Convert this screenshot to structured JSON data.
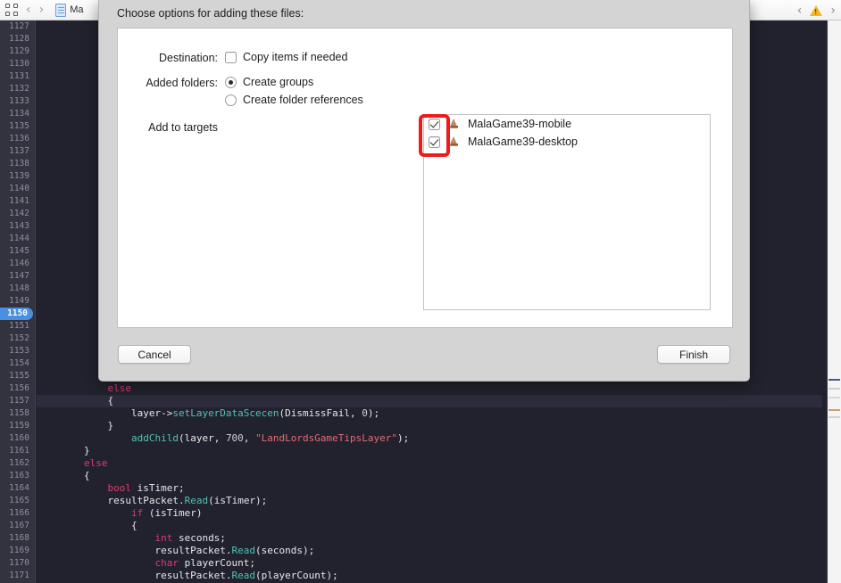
{
  "toolbar": {
    "grid_icon": "grid-panels-icon",
    "back_label": "‹",
    "forward_label": "›",
    "tab_label": "Ma",
    "nav_prev_label": "‹",
    "nav_next_label": "›",
    "warning_icon": "warning-triangle-icon"
  },
  "dialog": {
    "title": "Choose options for adding these files:",
    "destination": {
      "label": "Destination:",
      "checkbox_label": "Copy items if needed",
      "checked": false
    },
    "added_folders": {
      "label": "Added folders:",
      "options": [
        {
          "label": "Create groups",
          "selected": true
        },
        {
          "label": "Create folder references",
          "selected": false
        }
      ]
    },
    "add_to_targets": {
      "label": "Add to targets",
      "items": [
        {
          "label": "MalaGame39-mobile",
          "checked": true,
          "icon": "target-icon"
        },
        {
          "label": "MalaGame39-desktop",
          "checked": true,
          "icon": "target-icon"
        }
      ]
    },
    "cancel_label": "Cancel",
    "finish_label": "Finish",
    "annotation_color": "#ee1b1b"
  },
  "editor": {
    "first_line_number": 1127,
    "current_line": 1157,
    "marker_line": 1150,
    "accent_blue": "#4a8fe0",
    "background": "#22222e",
    "gutter_background": "#33333f",
    "lines": [
      {
        "n": 1127,
        "tokens": []
      },
      {
        "n": 1128,
        "tokens": []
      },
      {
        "n": 1129,
        "tokens": []
      },
      {
        "n": 1130,
        "tokens": []
      },
      {
        "n": 1131,
        "tokens": []
      },
      {
        "n": 1132,
        "tokens": []
      },
      {
        "n": 1133,
        "tokens": []
      },
      {
        "n": 1134,
        "tokens": []
      },
      {
        "n": 1135,
        "tokens": []
      },
      {
        "n": 1136,
        "tokens": []
      },
      {
        "n": 1137,
        "tokens": []
      },
      {
        "n": 1138,
        "tokens": []
      },
      {
        "n": 1139,
        "tokens": []
      },
      {
        "n": 1140,
        "tokens": []
      },
      {
        "n": 1141,
        "tokens": []
      },
      {
        "n": 1142,
        "tokens": []
      },
      {
        "n": 1143,
        "tokens": []
      },
      {
        "n": 1144,
        "tokens": []
      },
      {
        "n": 1145,
        "tokens": []
      },
      {
        "n": 1146,
        "tokens": []
      },
      {
        "n": 1147,
        "tokens": []
      },
      {
        "n": 1148,
        "tokens": []
      },
      {
        "n": 1149,
        "tokens": []
      },
      {
        "n": 1150,
        "tokens": [],
        "marker": true
      },
      {
        "n": 1151,
        "tokens": []
      },
      {
        "n": 1152,
        "tokens": []
      },
      {
        "n": 1153,
        "tokens": []
      },
      {
        "n": 1154,
        "tokens": []
      },
      {
        "n": 1155,
        "tokens": [
          {
            "t": "            }",
            "c": "pl"
          }
        ]
      },
      {
        "n": 1156,
        "tokens": [
          {
            "t": "            ",
            "c": "pl"
          },
          {
            "t": "else",
            "c": "kw"
          }
        ]
      },
      {
        "n": 1157,
        "tokens": [
          {
            "t": "            {",
            "c": "pl"
          }
        ],
        "highlight": true
      },
      {
        "n": 1158,
        "tokens": [
          {
            "t": "                layer->",
            "c": "pl"
          },
          {
            "t": "setLayerDataScecen",
            "c": "fn"
          },
          {
            "t": "(DismissFail, ",
            "c": "pl"
          },
          {
            "t": "0",
            "c": "num"
          },
          {
            "t": ");",
            "c": "pl"
          }
        ]
      },
      {
        "n": 1159,
        "tokens": [
          {
            "t": "            }",
            "c": "pl"
          }
        ]
      },
      {
        "n": 1160,
        "tokens": [
          {
            "t": "                ",
            "c": "pl"
          },
          {
            "t": "addChild",
            "c": "fn"
          },
          {
            "t": "(layer, ",
            "c": "pl"
          },
          {
            "t": "700",
            "c": "num"
          },
          {
            "t": ", ",
            "c": "pl"
          },
          {
            "t": "\"LandLordsGameTipsLayer\"",
            "c": "str"
          },
          {
            "t": ");",
            "c": "pl"
          }
        ]
      },
      {
        "n": 1161,
        "tokens": [
          {
            "t": "        }",
            "c": "pl"
          }
        ]
      },
      {
        "n": 1162,
        "tokens": [
          {
            "t": "        ",
            "c": "pl"
          },
          {
            "t": "else",
            "c": "kw"
          }
        ]
      },
      {
        "n": 1163,
        "tokens": [
          {
            "t": "        {",
            "c": "pl"
          }
        ]
      },
      {
        "n": 1164,
        "tokens": [
          {
            "t": "            ",
            "c": "pl"
          },
          {
            "t": "bool",
            "c": "kw"
          },
          {
            "t": " isTimer;",
            "c": "pl"
          }
        ]
      },
      {
        "n": 1165,
        "tokens": [
          {
            "t": "            resultPacket.",
            "c": "pl"
          },
          {
            "t": "Read",
            "c": "fn"
          },
          {
            "t": "(isTimer);",
            "c": "pl"
          }
        ]
      },
      {
        "n": 1166,
        "tokens": [
          {
            "t": "                ",
            "c": "pl"
          },
          {
            "t": "if",
            "c": "kw"
          },
          {
            "t": " (isTimer)",
            "c": "pl"
          }
        ]
      },
      {
        "n": 1167,
        "tokens": [
          {
            "t": "                {",
            "c": "pl"
          }
        ]
      },
      {
        "n": 1168,
        "tokens": [
          {
            "t": "                    ",
            "c": "pl"
          },
          {
            "t": "int",
            "c": "kw"
          },
          {
            "t": " seconds;",
            "c": "pl"
          }
        ]
      },
      {
        "n": 1169,
        "tokens": [
          {
            "t": "                    resultPacket.",
            "c": "pl"
          },
          {
            "t": "Read",
            "c": "fn"
          },
          {
            "t": "(seconds);",
            "c": "pl"
          }
        ]
      },
      {
        "n": 1170,
        "tokens": [
          {
            "t": "                    ",
            "c": "pl"
          },
          {
            "t": "char",
            "c": "kw"
          },
          {
            "t": " playerCount;",
            "c": "pl"
          }
        ]
      },
      {
        "n": 1171,
        "tokens": [
          {
            "t": "                    resultPacket.",
            "c": "pl"
          },
          {
            "t": "Read",
            "c": "fn"
          },
          {
            "t": "(playerCount);",
            "c": "pl"
          }
        ]
      }
    ]
  }
}
